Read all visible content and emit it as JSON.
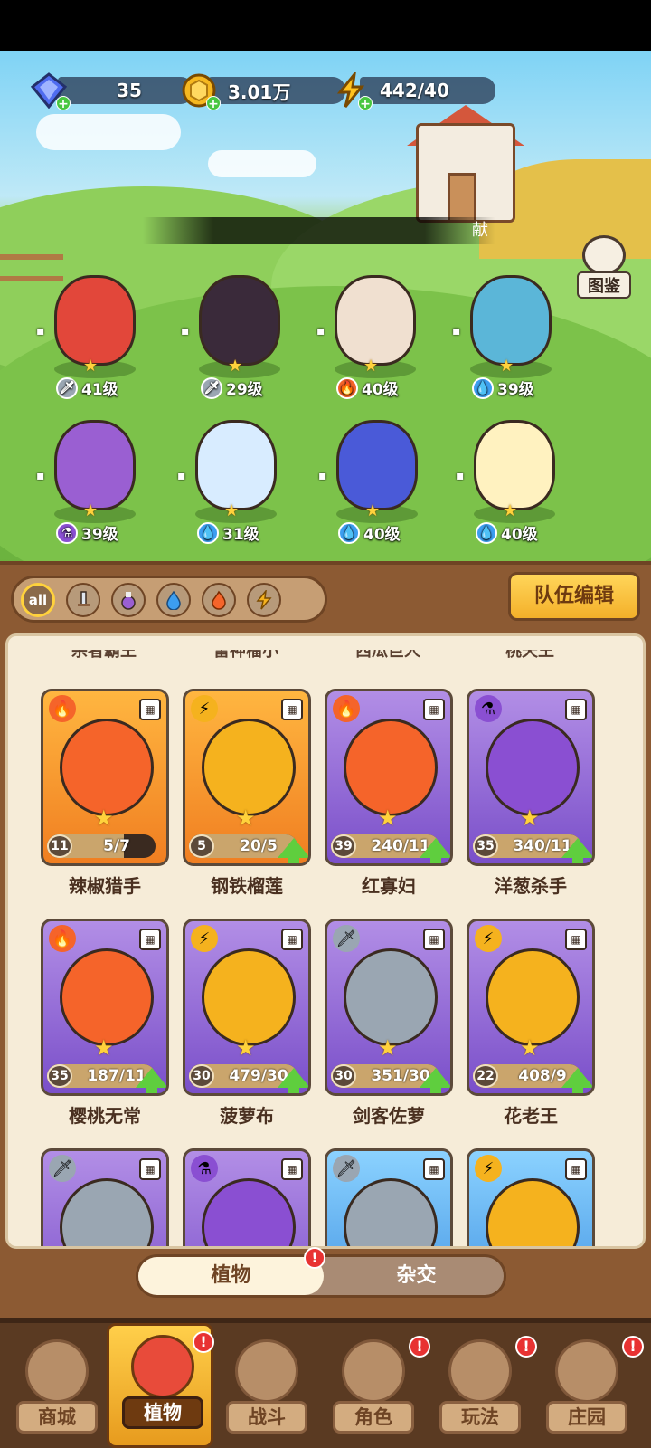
{
  "resources": {
    "gems": "35",
    "coins": "3.01万",
    "energy": "442/40"
  },
  "scene": {
    "banner_text": "献",
    "codex_label": "图鉴",
    "heroes": [
      {
        "level": "41级",
        "element": "sword",
        "color": "#e2473a"
      },
      {
        "level": "29级",
        "element": "sword",
        "color": "#3a2a3a"
      },
      {
        "level": "40级",
        "element": "fire",
        "color": "#f0e0d0"
      },
      {
        "level": "39级",
        "element": "water",
        "color": "#5bb6d8"
      },
      {
        "level": "39级",
        "element": "potion",
        "color": "#9a5fd2"
      },
      {
        "level": "31级",
        "element": "water",
        "color": "#d8ecff"
      },
      {
        "level": "40级",
        "element": "water",
        "color": "#4a5ad8"
      },
      {
        "level": "40级",
        "element": "water",
        "color": "#fff2c0"
      }
    ]
  },
  "filters": {
    "all_label": "all",
    "team_edit": "队伍编辑"
  },
  "roster": {
    "prev_row_names": [
      "杀者霸王",
      "雷神榴小",
      "西瓜巨人",
      "桃天王"
    ],
    "cards": [
      {
        "name": "辣椒猎手",
        "level": "11",
        "count": "5/7",
        "fill": 0.71,
        "tier": "orange",
        "element": "fire",
        "upgrade": false
      },
      {
        "name": "钢铁榴莲",
        "level": "5",
        "count": "20/5",
        "fill": 1,
        "tier": "orange",
        "element": "lightning",
        "upgrade": true
      },
      {
        "name": "红寡妇",
        "level": "39",
        "count": "240/11",
        "fill": 1,
        "tier": "purple",
        "element": "fire",
        "upgrade": true
      },
      {
        "name": "洋葱杀手",
        "level": "35",
        "count": "340/11",
        "fill": 1,
        "tier": "purple",
        "element": "potion",
        "upgrade": true
      },
      {
        "name": "樱桃无常",
        "level": "35",
        "count": "187/11",
        "fill": 1,
        "tier": "purple",
        "element": "fire",
        "upgrade": true
      },
      {
        "name": "菠萝布",
        "level": "30",
        "count": "479/30",
        "fill": 1,
        "tier": "purple",
        "element": "lightning",
        "upgrade": true
      },
      {
        "name": "剑客佐萝",
        "level": "30",
        "count": "351/30",
        "fill": 1,
        "tier": "purple",
        "element": "sword",
        "upgrade": true
      },
      {
        "name": "花老王",
        "level": "22",
        "count": "408/9",
        "fill": 1,
        "tier": "purple",
        "element": "lightning",
        "upgrade": true
      },
      {
        "name": "",
        "level": "",
        "count": "",
        "fill": 0,
        "tier": "purple",
        "element": "sword",
        "upgrade": false
      },
      {
        "name": "",
        "level": "",
        "count": "",
        "fill": 0,
        "tier": "purple",
        "element": "potion",
        "upgrade": false
      },
      {
        "name": "",
        "level": "",
        "count": "",
        "fill": 0,
        "tier": "blue",
        "element": "sword",
        "upgrade": false
      },
      {
        "name": "",
        "level": "",
        "count": "",
        "fill": 0,
        "tier": "blue",
        "element": "lightning",
        "upgrade": false
      }
    ]
  },
  "toggle": {
    "plants": "植物",
    "hybrid": "杂交"
  },
  "nav": [
    {
      "label": "商城",
      "active": false,
      "alert": false
    },
    {
      "label": "植物",
      "active": true,
      "alert": true
    },
    {
      "label": "战斗",
      "active": false,
      "alert": false
    },
    {
      "label": "角色",
      "active": false,
      "alert": true
    },
    {
      "label": "玩法",
      "active": false,
      "alert": true
    },
    {
      "label": "庄园",
      "active": false,
      "alert": true
    }
  ],
  "colors": {
    "fire": "#f5642a",
    "water": "#3c9ef0",
    "lightning": "#f5b21e",
    "potion": "#8a4fd2",
    "sword": "#9aa6b2"
  }
}
